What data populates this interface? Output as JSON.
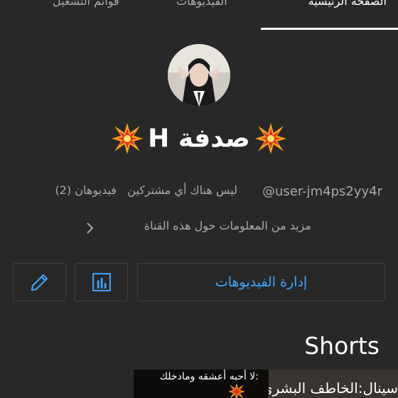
{
  "tabs": [
    {
      "label": "الصفحة الرئيسية",
      "active": true
    },
    {
      "label": "الفيديوهات",
      "active": false
    },
    {
      "label": "قوائم التشغيل",
      "active": false
    }
  ],
  "channel": {
    "title_text": "صدفة H",
    "title_emoji": "collision-icon",
    "handle": "@user-jm4ps2yy4r",
    "subscribers": "ليس هناك أي مشتركين",
    "videos": "فيديوهان (2)",
    "about_link": "مزيد من المعلومات حول هذه القناة"
  },
  "actions": {
    "manage_videos": "إدارة الفيديوهات",
    "stats_icon": "bar-chart-icon",
    "edit_icon": "pencil-icon"
  },
  "shorts": {
    "heading": "Shorts",
    "items": [
      {
        "caption": ":لا أحبه أعشقه ومادخلك"
      },
      {
        "caption": "سينال:الخاطف البشري"
      }
    ]
  },
  "colors": {
    "background": "#282828",
    "accent": "#3ea6ff",
    "secondary_text": "#aaaaaa",
    "border": "#3f3f3f"
  }
}
